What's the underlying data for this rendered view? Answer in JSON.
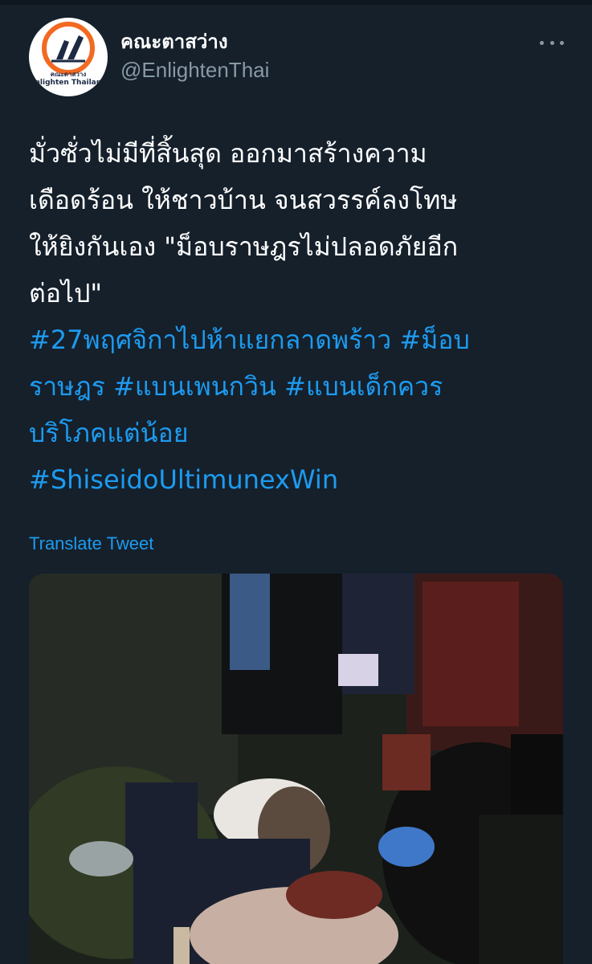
{
  "account": {
    "display_name": "คณะตาสว่าง",
    "handle": "@EnlightenThai",
    "avatar_top_text": "คณะตาสว่าง",
    "avatar_brand": "Enlighten Thailand"
  },
  "tweet": {
    "text_lines": [
      "มั่วซั่วไม่มีที่สิ้นสุด ออกมาสร้างความ",
      "เดือดร้อน ให้ชาวบ้าน จนสวรรค์ลงโทษ",
      " ให้ยิงกันเอง \"ม็อบราษฎรไม่ปลอดภัยอีก",
      "ต่อไป\""
    ],
    "hashtags": [
      " #27พฤศจิกาไปห้าแยกลาดพร้าว",
      "#ม็อบราษฎร",
      "#แบนเพนกวิน",
      "#แบนเด็กควรบริโภคแต่น้อย",
      "#ShiseidoUltimunexWin"
    ],
    "hashtag_lines": [
      [
        " #27พฤศจิกาไปห้าแยกลาดพร้าว",
        " #ม็อบ"
      ],
      [
        "ราษฎร",
        " #แบนเพนกวิน",
        " #แบนเด็กควร"
      ],
      [
        "บริโภคแต่น้อย"
      ],
      [
        "#ShiseidoUltimunexWin"
      ]
    ],
    "translate_label": "Translate Tweet"
  },
  "icons": {
    "more": "more-options-icon"
  },
  "colors": {
    "background": "#15202b",
    "link": "#1d9bf0",
    "secondary_text": "#8899a6"
  }
}
